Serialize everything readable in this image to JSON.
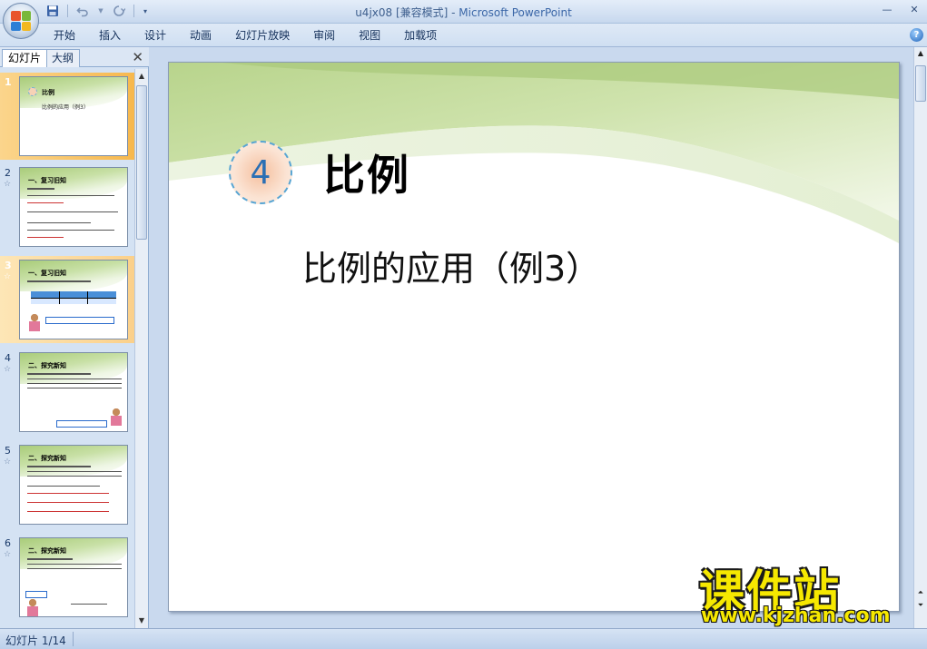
{
  "window": {
    "title_doc": "u4jx08 [兼容模式] - ",
    "title_app": "Microsoft PowerPoint",
    "minimize": "—",
    "close": "✕"
  },
  "qat": {
    "save_icon": "save-icon",
    "undo_icon": "undo-icon",
    "redo_icon": "redo-icon",
    "customize_icon": "dropdown-icon"
  },
  "ribbon": {
    "tabs": [
      "开始",
      "插入",
      "设计",
      "动画",
      "幻灯片放映",
      "审阅",
      "视图",
      "加载项"
    ],
    "help": "?"
  },
  "left_panel": {
    "tab_slides": "幻灯片",
    "tab_outline": "大纲",
    "close": "✕",
    "slides": [
      {
        "num": "1",
        "title": "比例",
        "sub": "比例的应用（例3）"
      },
      {
        "num": "2",
        "title": "一、复习旧知"
      },
      {
        "num": "3",
        "title": "一、复习旧知"
      },
      {
        "num": "4",
        "title": "二、探究新知"
      },
      {
        "num": "5",
        "title": "二、探究新知"
      },
      {
        "num": "6",
        "title": "二、探究新知"
      }
    ]
  },
  "slide": {
    "badge_number": "4",
    "title": "比例",
    "subtitle": "比例的应用（例3）"
  },
  "status": {
    "slide_info": "幻灯片 1/14"
  },
  "watermark": {
    "brand": "课件站",
    "url": "www.kjzhan.com"
  },
  "colors": {
    "selected_thumb": "#f7b84d",
    "badge_border": "#58a5d3",
    "badge_number": "#2a6fb4",
    "watermark": "#f6e800"
  }
}
